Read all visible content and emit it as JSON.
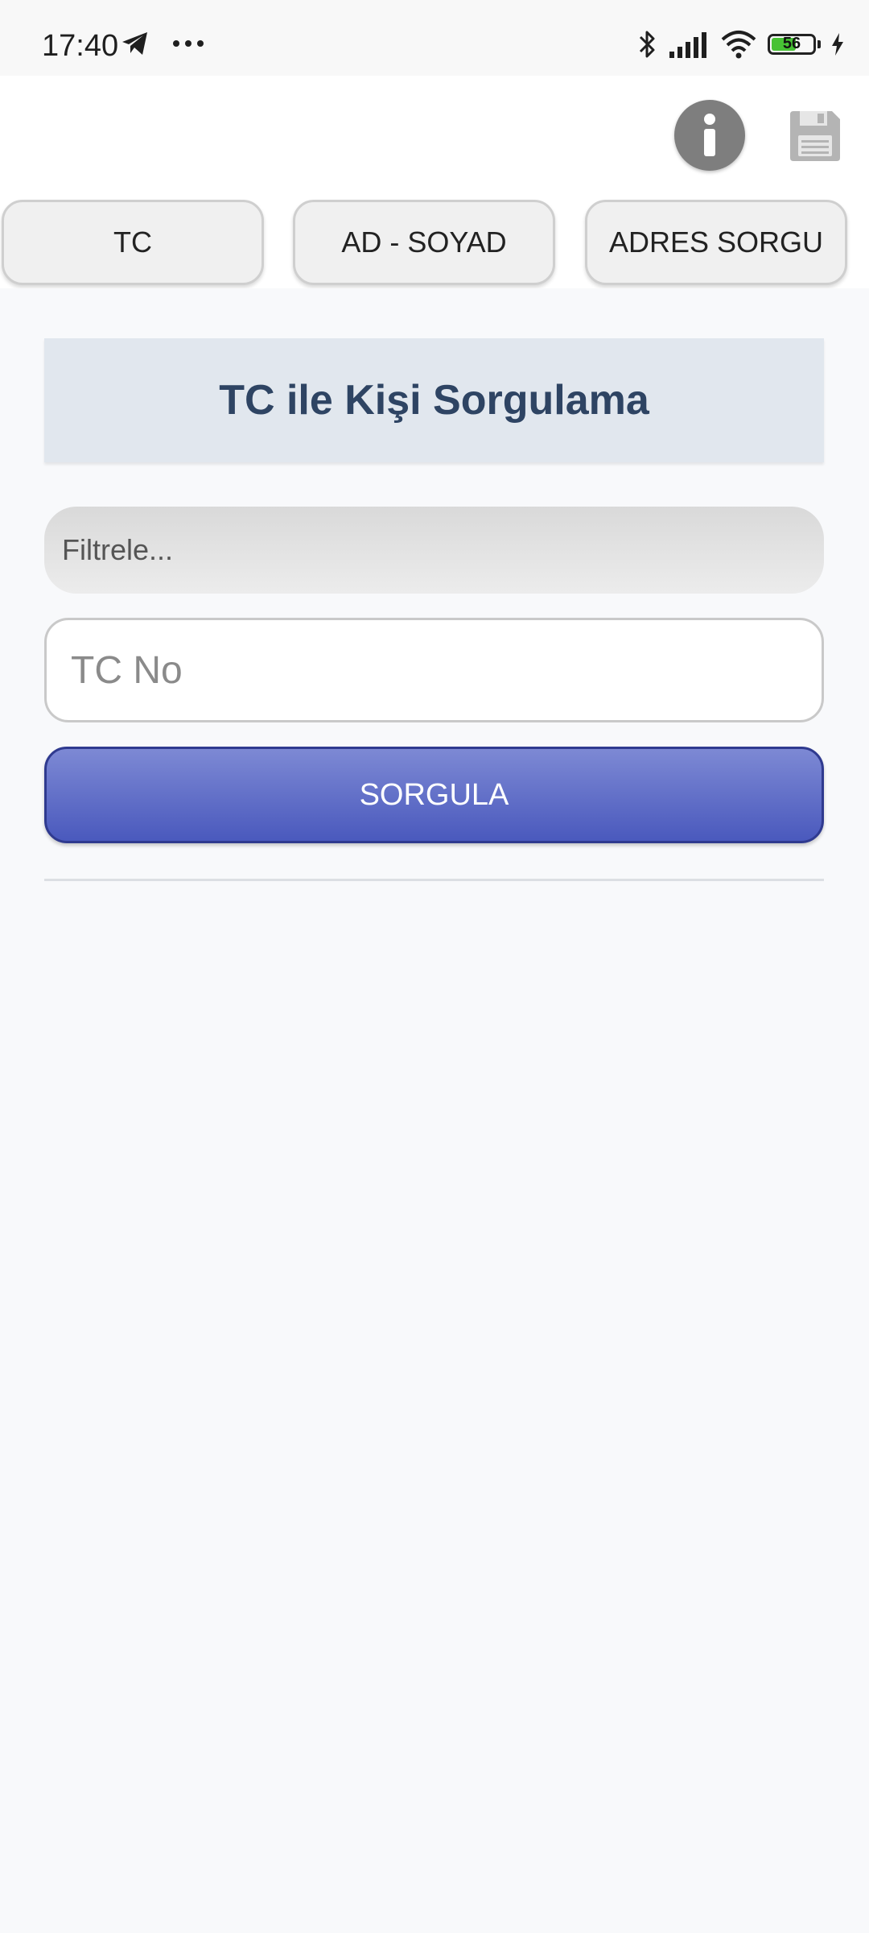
{
  "status_bar": {
    "time": "17:40",
    "battery_level": "56",
    "icons": [
      "telegram-icon",
      "more-icon",
      "bluetooth-icon",
      "signal-icon",
      "wifi-icon",
      "battery-icon",
      "charging-icon"
    ]
  },
  "toolbar": {
    "info_icon": "info-icon",
    "save_icon": "floppy-disk-icon"
  },
  "tabs": [
    {
      "label": "TC"
    },
    {
      "label": "AD - SOYAD"
    },
    {
      "label": "ADRES SORGU"
    }
  ],
  "main": {
    "title": "TC ile Kişi Sorgulama",
    "filter_placeholder": "Filtrele...",
    "tc_placeholder": "TC No",
    "query_button_label": "SORGULA"
  },
  "colors": {
    "title": "#2e4463",
    "button": "#5563c4",
    "header_bg": "#e1e7ee"
  }
}
